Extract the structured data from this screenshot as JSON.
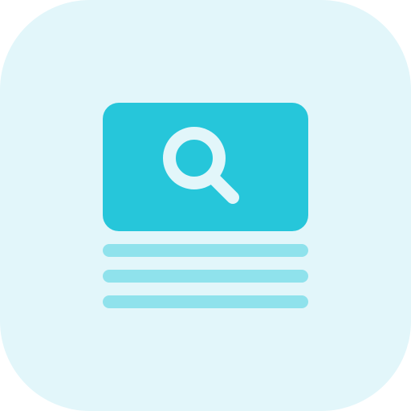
{
  "icon": {
    "name": "search-document-icon",
    "colors": {
      "background": "#E2F6FA",
      "card": "#26C6DA",
      "search_glyph": "#E2F6FA",
      "text_lines": "#8FE2EC"
    }
  }
}
